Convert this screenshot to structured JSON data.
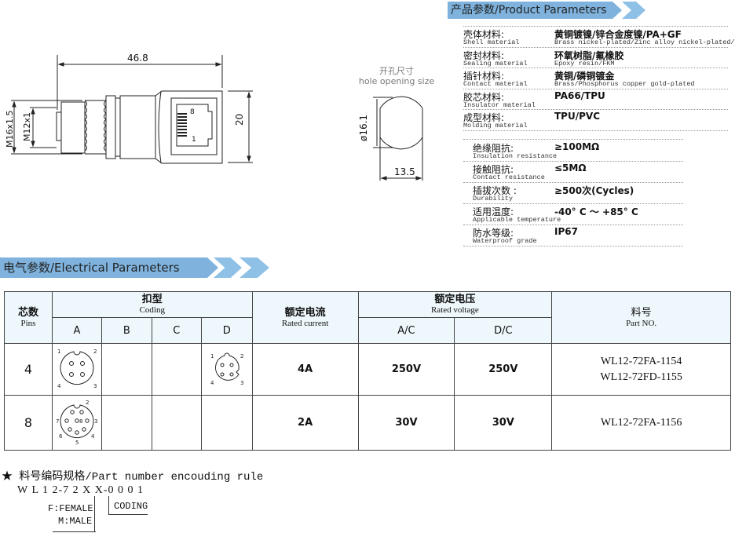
{
  "product_params": {
    "title": "产品参数/Product Parameters",
    "rows": [
      {
        "cn": "壳体材料:",
        "en": "Shell material",
        "value": "黄铜镀镍/锌合金度镍/PA+GF",
        "value_en": "Brass nickel-plated/Zinc alloy nickel-plated/PA-GF"
      },
      {
        "cn": "密封材料:",
        "en": "Sealing material",
        "value": "环氧树脂/氟橡胶",
        "value_en": "Epoxy resin/FKM"
      },
      {
        "cn": "插针材料:",
        "en": "Contact material",
        "value": "黄铜/磷铜镀金",
        "value_en": "Brass/Phosphorus copper gold-plated"
      },
      {
        "cn": "胶芯材料:",
        "en": "Insulator material",
        "value": "PA66/TPU",
        "value_en": ""
      },
      {
        "cn": "成型材料:",
        "en": "Molding material",
        "value": "TPU/PVC",
        "value_en": ""
      }
    ],
    "rows2": [
      {
        "cn": "绝缘阻抗:",
        "en": "Insulation resistance",
        "value": "≥100MΩ"
      },
      {
        "cn": "接触阻抗:",
        "en": "Contact resistance",
        "value": "≤5MΩ"
      },
      {
        "cn": "插拔次数 :",
        "en": "Durability",
        "value": "≥500次(Cycles)"
      },
      {
        "cn": "适用温度:",
        "en": "Applicable temperature",
        "value": "-40° C ～ +85° C"
      },
      {
        "cn": "防水等级:",
        "en": "Waterproof grade",
        "value": "IP67"
      }
    ]
  },
  "drawing": {
    "length": "46.8",
    "height": "20",
    "m16": "M16x1.5",
    "m12": "M12x1",
    "pin8": "8",
    "pin1": "1",
    "hole_cn": "开孔尺寸",
    "hole_en": "hole opening size",
    "hole_dia": "ø16.1",
    "hole_flat": "13.5"
  },
  "electrical": {
    "title": "电气参数/Electrical Parameters",
    "headers": {
      "pins_cn": "芯数",
      "pins_en": "Pins",
      "coding_cn": "扣型",
      "coding_en": "Coding",
      "codes": [
        "A",
        "B",
        "C",
        "D"
      ],
      "current_cn": "额定电流",
      "current_en": "Rated current",
      "voltage_cn": "额定电压",
      "voltage_en": "Rated voltage",
      "ac": "A/C",
      "dc": "D/C",
      "part_cn": "料号",
      "part_en": "Part NO."
    },
    "rows": [
      {
        "pins": "4",
        "current": "4A",
        "ac": "250V",
        "dc": "250V",
        "parts": [
          "WL12-72FA-1154",
          "WL12-72FD-1155"
        ]
      },
      {
        "pins": "8",
        "current": "2A",
        "ac": "30V",
        "dc": "30V",
        "parts": [
          "WL12-72FA-1156"
        ]
      }
    ]
  },
  "encoding": {
    "title": "★ 料号编码规格/Part number encouding rule",
    "code": "W L 1 2-7 2 X X-0 0 0 1",
    "gender": "F:FEMALE",
    "gender2": "M:MALE",
    "coding": "CODING"
  }
}
